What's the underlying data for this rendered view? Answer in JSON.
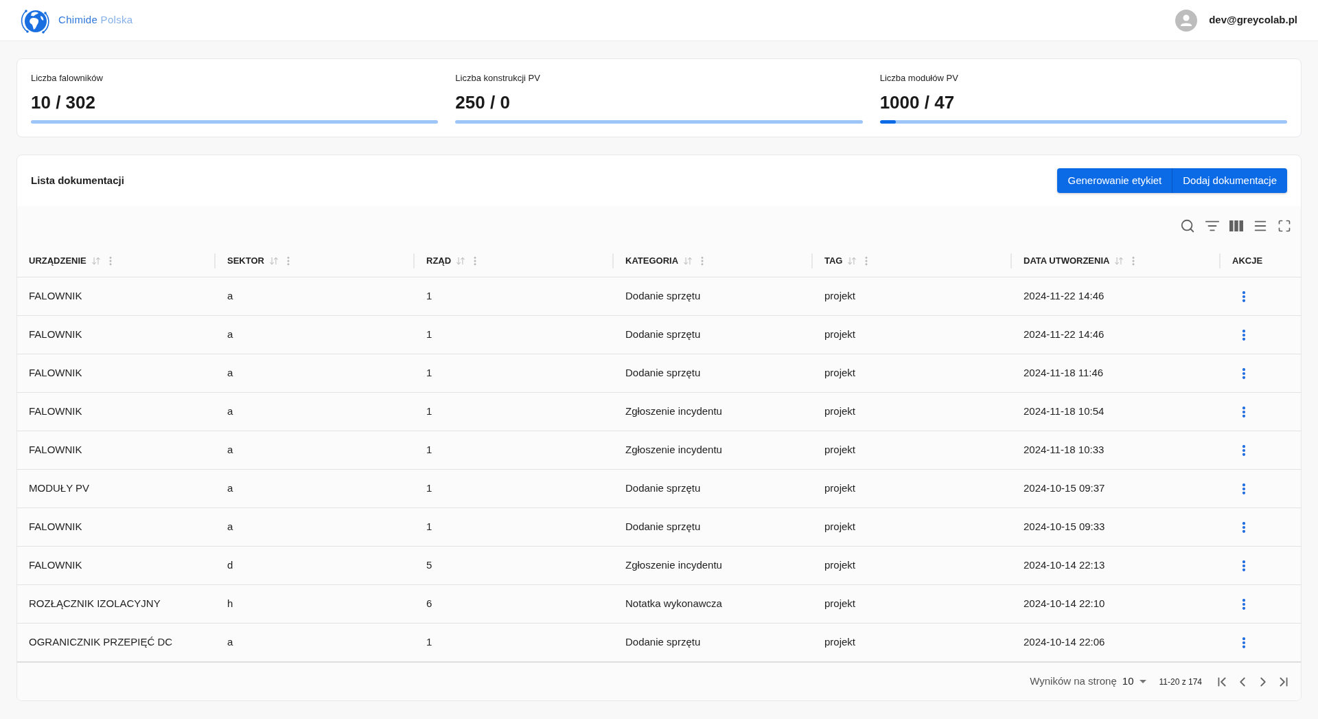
{
  "header": {
    "brand": {
      "name": "Chimide",
      "suffix": "Polska"
    },
    "user": {
      "email": "dev@greycolab.pl"
    }
  },
  "stats": [
    {
      "label": "Liczba falowników",
      "value": "10 / 302"
    },
    {
      "label": "Liczba konstrukcji PV",
      "value": "250 / 0"
    },
    {
      "label": "Liczba modułów PV",
      "value": "1000 / 47",
      "level": 0.04
    }
  ],
  "documentation": {
    "title": "Lista dokumentacji",
    "buttons": [
      "Generowanie etykiet",
      "Dodaj dokumentacje"
    ],
    "table": {
      "columns": [
        {
          "label": "URZĄDZENIE",
          "kind": "data"
        },
        {
          "label": "SEKTOR",
          "kind": "data"
        },
        {
          "label": "RZĄD",
          "kind": "data"
        },
        {
          "label": "KATEGORIA",
          "kind": "data"
        },
        {
          "label": "TAG",
          "kind": "data"
        },
        {
          "label": "DATA UTWORZENIA",
          "kind": "data"
        },
        {
          "label": "AKCJE",
          "kind": "actions"
        }
      ],
      "rows": [
        [
          "FALOWNIK",
          "a",
          "1",
          "Dodanie sprzętu",
          "projekt",
          "2024-11-22 14:46"
        ],
        [
          "FALOWNIK",
          "a",
          "1",
          "Dodanie sprzętu",
          "projekt",
          "2024-11-22 14:46"
        ],
        [
          "FALOWNIK",
          "a",
          "1",
          "Dodanie sprzętu",
          "projekt",
          "2024-11-18 11:46"
        ],
        [
          "FALOWNIK",
          "a",
          "1",
          "Zgłoszenie incydentu",
          "projekt",
          "2024-11-18 10:54"
        ],
        [
          "FALOWNIK",
          "a",
          "1",
          "Zgłoszenie incydentu",
          "projekt",
          "2024-11-18 10:33"
        ],
        [
          "MODUŁY PV",
          "a",
          "1",
          "Dodanie sprzętu",
          "projekt",
          "2024-10-15 09:37"
        ],
        [
          "FALOWNIK",
          "a",
          "1",
          "Dodanie sprzętu",
          "projekt",
          "2024-10-15 09:33"
        ],
        [
          "FALOWNIK",
          "d",
          "5",
          "Zgłoszenie incydentu",
          "projekt",
          "2024-10-14 22:13"
        ],
        [
          "ROZŁĄCZNIK IZOLACYJNY",
          "h",
          "6",
          "Notatka wykonawcza",
          "projekt",
          "2024-10-14 22:10"
        ],
        [
          "OGRANICZNIK PRZEPIĘĆ DC",
          "a",
          "1",
          "Dodanie sprzętu",
          "projekt",
          "2024-10-14 22:06"
        ]
      ]
    },
    "pagination": {
      "rows_per_page_label": "Wyników na stronę",
      "rows_per_page": "10",
      "range": "11-20 z 174"
    }
  }
}
